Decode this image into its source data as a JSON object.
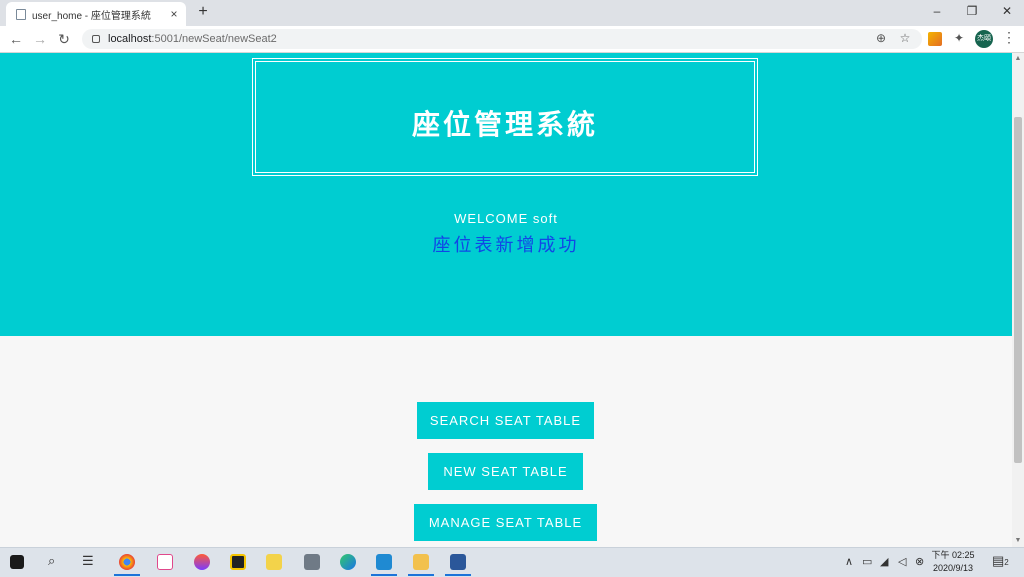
{
  "browser": {
    "tab_title": "user_home - 座位管理系統",
    "tab_close": "×",
    "new_tab": "+",
    "url_host": "localhost",
    "url_path": ":5001/newSeat/newSeat2",
    "avatar_text": "杰頤"
  },
  "header": {
    "system_title": "座位管理系統",
    "welcome": "WELCOME soft",
    "status_message": "座位表新增成功"
  },
  "menu": {
    "search": "SEARCH SEAT TABLE",
    "new": "NEW SEAT TABLE",
    "manage": "MANAGE SEAT TABLE"
  },
  "taskbar": {
    "time": "下午 02:25",
    "date": "2020/9/13",
    "notification_count": "2"
  },
  "colors": {
    "accent": "#00cdd1",
    "status_text": "#1146e6"
  }
}
